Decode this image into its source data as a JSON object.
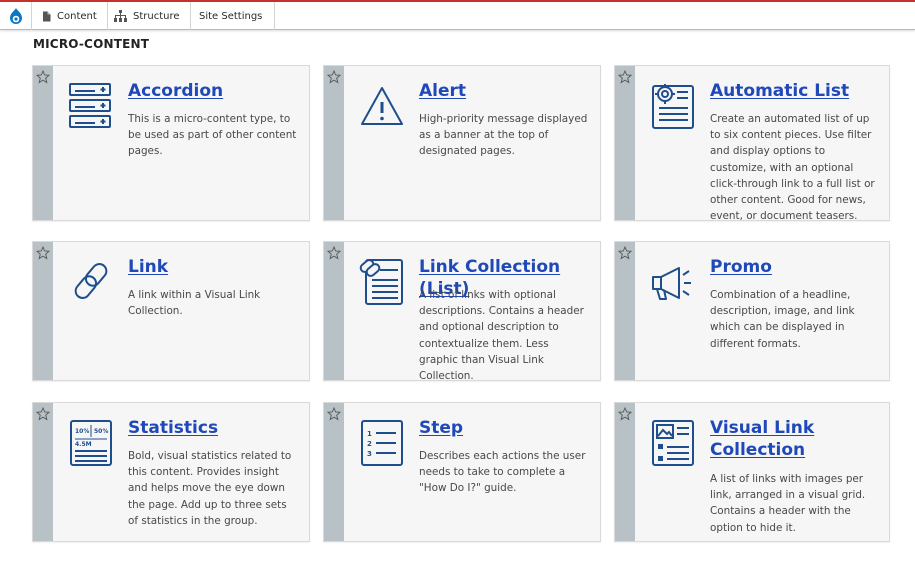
{
  "toolbar": {
    "logo_icon": "drupal-drop-icon",
    "items": [
      {
        "label": "Content",
        "icon": "document-icon"
      },
      {
        "label": "Structure",
        "icon": "sitemap-icon"
      },
      {
        "label": "Site Settings",
        "icon": ""
      }
    ],
    "accent_color": "#c5312b"
  },
  "section": {
    "title": "MICRO-CONTENT"
  },
  "cards": [
    {
      "title": "Accordion",
      "icon": "accordion-icon",
      "description": "This is a micro-content type, to be used as part of other content pages."
    },
    {
      "title": "Alert",
      "icon": "alert-triangle-icon",
      "description": "High-priority message displayed as a banner at the top of designated pages."
    },
    {
      "title": "Automatic List",
      "icon": "automatic-list-icon",
      "description": "Create an automated list of up to six content pieces. Use filter and display options to customize, with an optional click-through link to a full list or other content. Good for news, event, or document teasers."
    },
    {
      "title": "Link",
      "icon": "chain-link-icon",
      "description": "A link within a Visual Link Collection."
    },
    {
      "title": "Link Collection (List)",
      "icon": "link-collection-icon",
      "description": "A list of links with optional descriptions. Contains a header and optional description to contextualize them. Less graphic than Visual Link Collection."
    },
    {
      "title": "Promo",
      "icon": "megaphone-icon",
      "description": "Combination of a headline, description, image, and link which can be displayed in different formats."
    },
    {
      "title": "Statistics",
      "icon": "statistics-icon",
      "description": "Bold, visual statistics related to this content. Provides insight and helps move the eye down the page. Add up to three sets of statistics in the group."
    },
    {
      "title": "Step",
      "icon": "numbered-steps-icon",
      "description": "Describes each actions the user needs to take to complete a \"How Do I?\" guide."
    },
    {
      "title": "Visual Link Collection",
      "icon": "visual-link-collection-icon",
      "description": "A list of links with images per link, arranged in a visual grid. Contains a header with the option to hide it."
    }
  ],
  "stat_icon_text": [
    "10%",
    "50%",
    "4.5M"
  ],
  "colors": {
    "link": "#1f48b8",
    "icon": "#1f4e8c",
    "stripe": "#b7c1c6",
    "card_bg": "#f6f6f6"
  }
}
